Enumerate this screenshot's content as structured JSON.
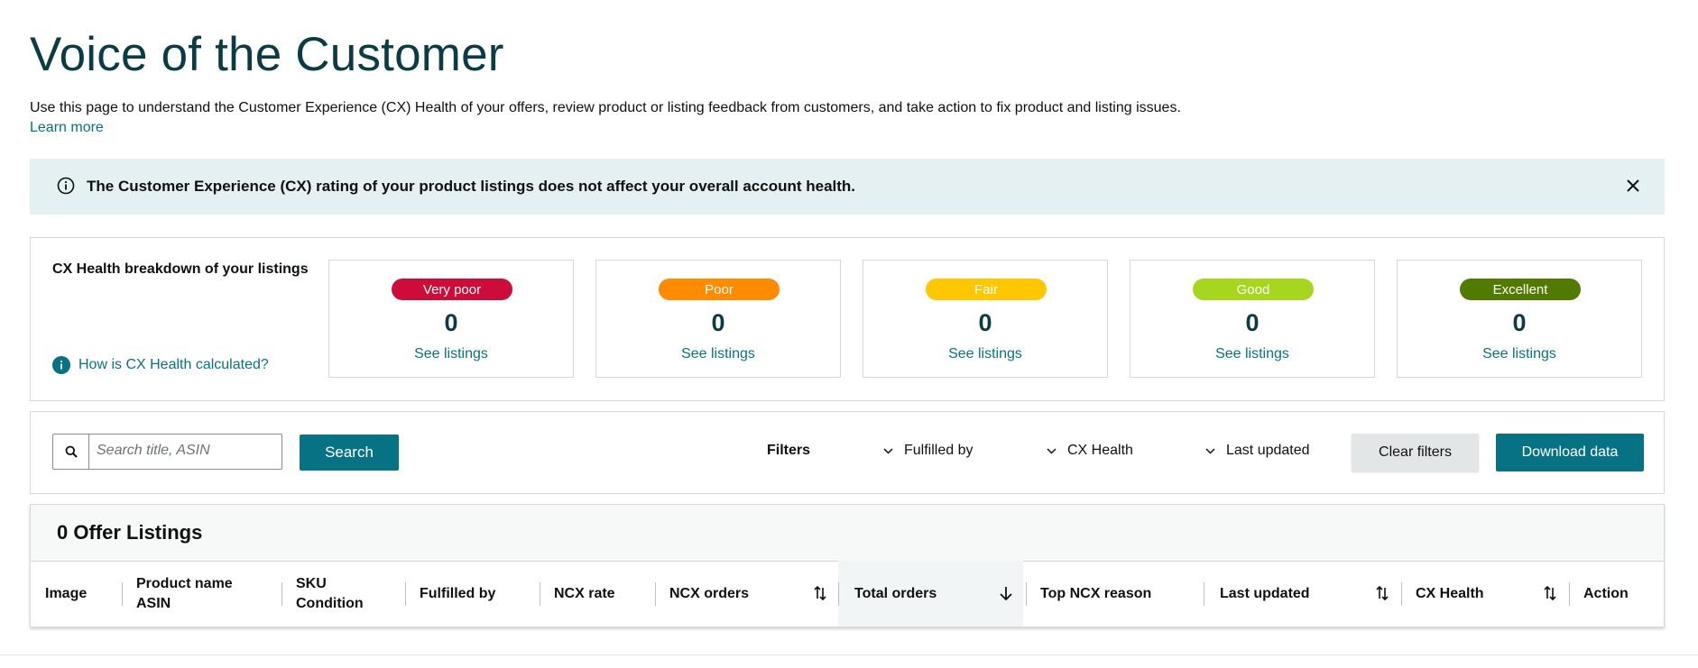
{
  "page": {
    "title": "Voice of the Customer",
    "description": "Use this page to understand the Customer Experience (CX) Health of your offers, review product or listing feedback from customers, and take action to fix product and listing issues.",
    "learn_more": "Learn more"
  },
  "banner": {
    "message": "The Customer Experience (CX) rating of your product listings does not affect your overall account health.",
    "icon": "info-circle-icon",
    "close_icon": "close-icon"
  },
  "breakdown": {
    "title": "CX Health breakdown of your listings",
    "how_link": "How is CX Health calculated?",
    "tiles": [
      {
        "label": "Very poor",
        "count": "0",
        "link": "See listings",
        "color": "#cc0c39"
      },
      {
        "label": "Poor",
        "count": "0",
        "link": "See listings",
        "color": "#ff8c00"
      },
      {
        "label": "Fair",
        "count": "0",
        "link": "See listings",
        "color": "#ffc700"
      },
      {
        "label": "Good",
        "count": "0",
        "link": "See listings",
        "color": "#a6d61e"
      },
      {
        "label": "Excellent",
        "count": "0",
        "link": "See listings",
        "color": "#507a00"
      }
    ]
  },
  "filters": {
    "search_placeholder": "Search title, ASIN",
    "search_value": "",
    "search_button": "Search",
    "label": "Filters",
    "dropdowns": [
      "Fulfilled by",
      "CX Health",
      "Last updated"
    ],
    "clear_button": "Clear filters",
    "download_button": "Download data"
  },
  "table": {
    "title": "0 Offer Listings",
    "columns": [
      {
        "line1": "Image",
        "line2": ""
      },
      {
        "line1": "Product name",
        "line2": "ASIN"
      },
      {
        "line1": "SKU",
        "line2": "Condition"
      },
      {
        "line1": "Fulfilled by",
        "line2": ""
      },
      {
        "line1": "NCX rate",
        "line2": ""
      },
      {
        "line1": "NCX orders",
        "line2": ""
      },
      {
        "line1": "Total orders",
        "line2": ""
      },
      {
        "line1": "Top NCX reason",
        "line2": ""
      },
      {
        "line1": "Last updated",
        "line2": ""
      },
      {
        "line1": "CX Health",
        "line2": ""
      },
      {
        "line1": "Action",
        "line2": ""
      }
    ]
  },
  "colors": {
    "accent": "#077284",
    "title": "#0b3b44",
    "banner_bg": "#e4f0f1"
  }
}
